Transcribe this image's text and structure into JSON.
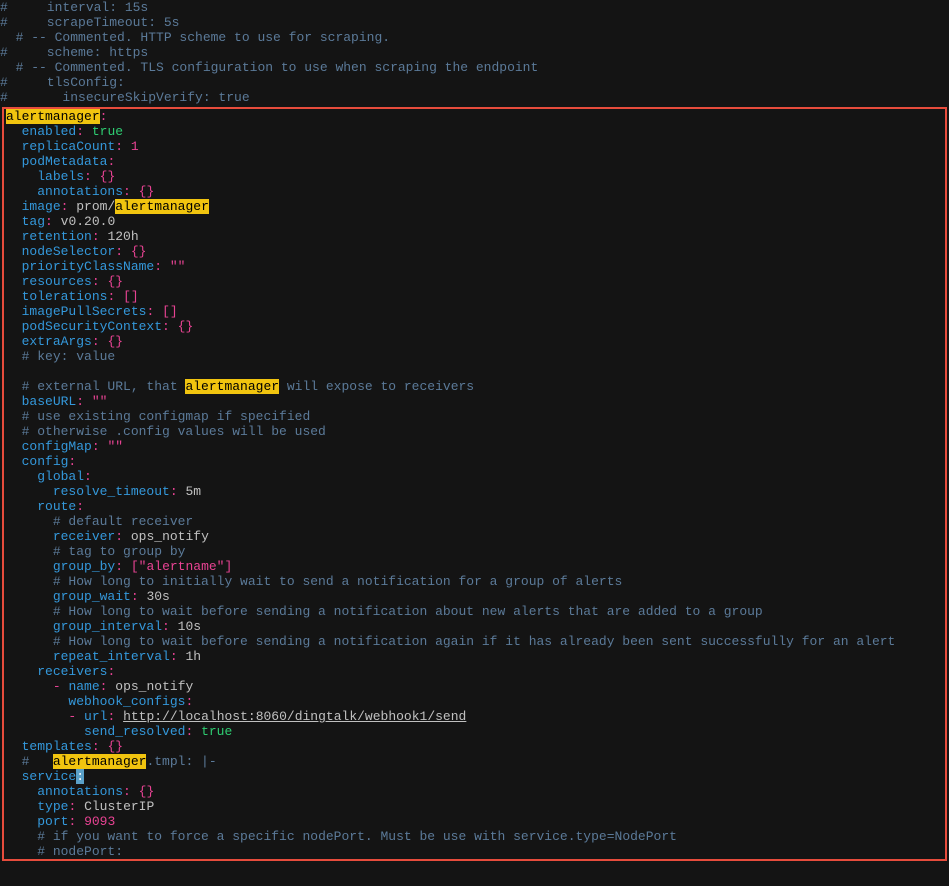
{
  "top_comments": [
    "#     interval: 15s",
    "#     scrapeTimeout: 5s",
    "  # -- Commented. HTTP scheme to use for scraping.",
    "#     scheme: https",
    "  # -- Commented. TLS configuration to use when scraping the endpoint",
    "#     tlsConfig:",
    "#       insecureSkipVerify: true"
  ],
  "alertmanager": {
    "enabled": "true",
    "replicaCount": "1",
    "podMetadata_labels": "{}",
    "podMetadata_annotations": "{}",
    "image_prefix": "prom/",
    "tag": "v0.20.0",
    "retention": "120h",
    "nodeSelector": "{}",
    "priorityClassName": "\"\"",
    "resources": "{}",
    "tolerations": "[]",
    "imagePullSecrets": "[]",
    "podSecurityContext": "{}",
    "extraArgs": "{}",
    "cmt_keyvalue": "# key: value",
    "cmt_ext_url_pre": "# external URL, that ",
    "cmt_ext_url_post": " will expose to receivers",
    "baseURL": "\"\"",
    "cmt_cfgmap1": "# use existing configmap if specified",
    "cmt_cfgmap2": "# otherwise .config values will be used",
    "configMap": "\"\"",
    "resolve_timeout": "5m",
    "cmt_default_recv": "# default receiver",
    "receiver": "ops_notify",
    "cmt_tag": "# tag to group by",
    "group_by": "\"alertname\"",
    "cmt_howlong1": "# How long to initially wait to send a notification for a group of alerts",
    "group_wait": "30s",
    "cmt_howlong2": "# How long to wait before sending a notification about new alerts that are added to a group",
    "group_interval": "10s",
    "cmt_howlong3": "# How long to wait before sending a notification again if it has already been sent successfully for an alert",
    "repeat_interval": "1h",
    "recv_name": "ops_notify",
    "webhook_url": "http://localhost:8060/dingtalk/webhook1/send",
    "send_resolved": "true",
    "templates": "{}",
    "cmt_tmpl_post": ".tmpl: |-",
    "svc_annotations": "{}",
    "svc_type": "ClusterIP",
    "svc_port": "9093",
    "cmt_nodeport1": "# if you want to force a specific nodePort. Must be use with service.type=NodePort",
    "cmt_nodeport2": "# nodePort:"
  },
  "hl_word": "alertmanager",
  "chart_data": {
    "type": "table",
    "title": "alertmanager Helm values (YAML)",
    "rows": [
      {
        "path": "alertmanager.enabled",
        "value": true
      },
      {
        "path": "alertmanager.replicaCount",
        "value": 1
      },
      {
        "path": "alertmanager.podMetadata.labels",
        "value": {}
      },
      {
        "path": "alertmanager.podMetadata.annotations",
        "value": {}
      },
      {
        "path": "alertmanager.image",
        "value": "prom/alertmanager"
      },
      {
        "path": "alertmanager.tag",
        "value": "v0.20.0"
      },
      {
        "path": "alertmanager.retention",
        "value": "120h"
      },
      {
        "path": "alertmanager.nodeSelector",
        "value": {}
      },
      {
        "path": "alertmanager.priorityClassName",
        "value": ""
      },
      {
        "path": "alertmanager.resources",
        "value": {}
      },
      {
        "path": "alertmanager.tolerations",
        "value": []
      },
      {
        "path": "alertmanager.imagePullSecrets",
        "value": []
      },
      {
        "path": "alertmanager.podSecurityContext",
        "value": {}
      },
      {
        "path": "alertmanager.extraArgs",
        "value": {}
      },
      {
        "path": "alertmanager.baseURL",
        "value": ""
      },
      {
        "path": "alertmanager.configMap",
        "value": ""
      },
      {
        "path": "alertmanager.config.global.resolve_timeout",
        "value": "5m"
      },
      {
        "path": "alertmanager.config.route.receiver",
        "value": "ops_notify"
      },
      {
        "path": "alertmanager.config.route.group_by",
        "value": [
          "alertname"
        ]
      },
      {
        "path": "alertmanager.config.route.group_wait",
        "value": "30s"
      },
      {
        "path": "alertmanager.config.route.group_interval",
        "value": "10s"
      },
      {
        "path": "alertmanager.config.route.repeat_interval",
        "value": "1h"
      },
      {
        "path": "alertmanager.config.receivers[0].name",
        "value": "ops_notify"
      },
      {
        "path": "alertmanager.config.receivers[0].webhook_configs[0].url",
        "value": "http://localhost:8060/dingtalk/webhook1/send"
      },
      {
        "path": "alertmanager.config.receivers[0].webhook_configs[0].send_resolved",
        "value": true
      },
      {
        "path": "alertmanager.templates",
        "value": {}
      },
      {
        "path": "alertmanager.service.annotations",
        "value": {}
      },
      {
        "path": "alertmanager.service.type",
        "value": "ClusterIP"
      },
      {
        "path": "alertmanager.service.port",
        "value": 9093
      }
    ]
  }
}
